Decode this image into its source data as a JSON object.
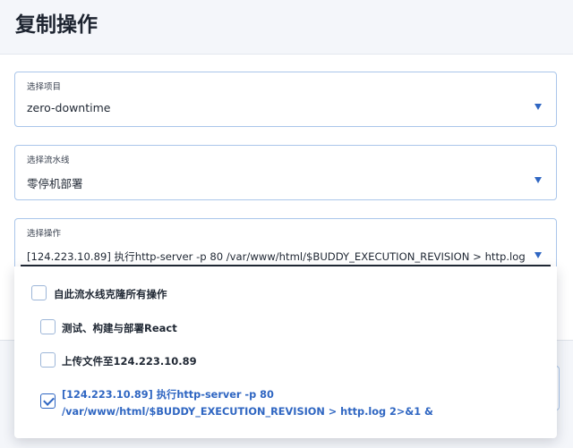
{
  "page": {
    "title": "复制操作"
  },
  "fields": {
    "project": {
      "label": "选择项目",
      "value": "zero-downtime"
    },
    "pipeline": {
      "label": "选择流水线",
      "value": "零停机部署"
    },
    "action": {
      "label": "选择操作",
      "value": "[124.223.10.89] 执行http-server -p 80 /var/www/html/$BUDDY_EXECUTION_REVISION > http.log 2>&1 &"
    }
  },
  "dropdown": {
    "select_all": {
      "label": "自此流水线克隆所有操作",
      "checked": false
    },
    "items": [
      {
        "label": "测试、构建与部署React",
        "checked": false
      },
      {
        "label": "上传文件至124.223.10.89",
        "checked": false
      },
      {
        "label": "[124.223.10.89] 执行http-server -p 80 /var/www/html/$BUDDY_EXECUTION_REVISION > http.log 2>&1 &",
        "checked": true
      }
    ]
  },
  "colors": {
    "accent": "#2f66c2",
    "border": "#aac6ea"
  },
  "icons": {
    "caret": "caret-down-icon",
    "check": "check-icon"
  }
}
